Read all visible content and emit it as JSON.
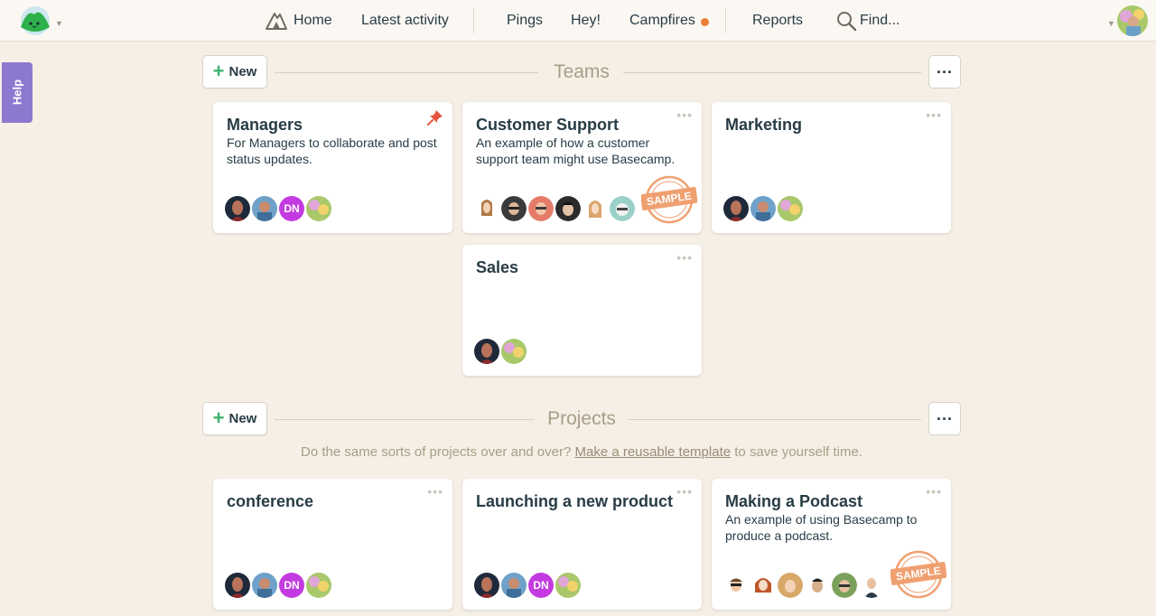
{
  "nav": {
    "home": "Home",
    "latest_activity": "Latest activity",
    "pings": "Pings",
    "hey": "Hey!",
    "campfires": "Campfires",
    "reports": "Reports",
    "find": "Find..."
  },
  "help": {
    "label": "Help"
  },
  "teams": {
    "title": "Teams",
    "new_label": "New",
    "cards": [
      {
        "title": "Managers",
        "description": "For Managers to collaborate and post status updates.",
        "pinned": true,
        "avatars": [
          "person-1",
          "person-2",
          "DN",
          "person-3"
        ]
      },
      {
        "title": "Customer Support",
        "description": "An example of how a customer support team might use Basecamp.",
        "sample": true,
        "avatars": [
          "cartoon-1",
          "cartoon-2",
          "cartoon-3",
          "cartoon-4",
          "cartoon-5",
          "cartoon-6"
        ]
      },
      {
        "title": "Marketing",
        "description": "",
        "avatars": [
          "person-1",
          "person-2",
          "person-3"
        ]
      },
      {
        "title": "Sales",
        "description": "",
        "avatars": [
          "person-1",
          "person-3"
        ]
      }
    ]
  },
  "projects": {
    "title": "Projects",
    "new_label": "New",
    "hint_before": "Do the same sorts of projects over and over?",
    "hint_link": "Make a reusable template",
    "hint_after": "to save yourself time.",
    "cards": [
      {
        "title": "conference",
        "description": "",
        "avatars": [
          "person-1",
          "person-2",
          "DN",
          "person-3"
        ]
      },
      {
        "title": "Launching a new product",
        "description": "",
        "avatars": [
          "person-1",
          "person-2",
          "DN",
          "person-3"
        ]
      },
      {
        "title": "Making a Podcast",
        "description": "An example of using Basecamp to produce a podcast.",
        "sample": true,
        "avatars": [
          "cartoon-1",
          "cartoon-2",
          "cartoon-3",
          "cartoon-4",
          "cartoon-5",
          "cartoon-6"
        ]
      }
    ]
  },
  "badges": {
    "sample": "SAMPLE",
    "dn": "DN"
  },
  "colors": {
    "accent_green": "#3cb371",
    "campfire_dot": "#e9813a",
    "help_purple": "#8d78cf",
    "dn_purple": "#c33be0",
    "sample_orange": "#f0a070"
  }
}
